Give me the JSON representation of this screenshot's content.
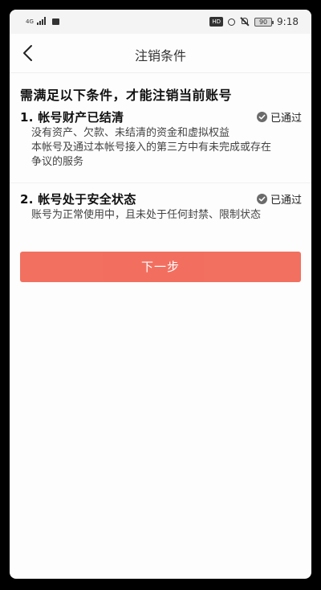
{
  "status_bar": {
    "network": "4G",
    "hd_badge": "HD",
    "battery": "90",
    "time": "9:18"
  },
  "nav": {
    "title": "注销条件",
    "back_icon": "back-arrow-icon"
  },
  "headline": "需满足以下条件，才能注销当前账号",
  "conditions": [
    {
      "title": "1. 帐号财产已结清",
      "status": "已通过",
      "status_icon": "check-circle-icon",
      "desc": [
        "没有资产、欠款、未结清的资金和虚拟权益",
        "本帐号及通过本帐号接入的第三方中有未完成或存在",
        "争议的服务"
      ]
    },
    {
      "title": "2. 帐号处于安全状态",
      "status": "已通过",
      "status_icon": "check-circle-icon",
      "desc": [
        "账号为正常使用中，且未处于任何封禁、限制状态"
      ]
    }
  ],
  "next_button": {
    "label": "下一步",
    "color": "#f26b5b"
  },
  "colors": {
    "accent": "#f26b5b",
    "passed_icon": "#6b6b6b"
  }
}
